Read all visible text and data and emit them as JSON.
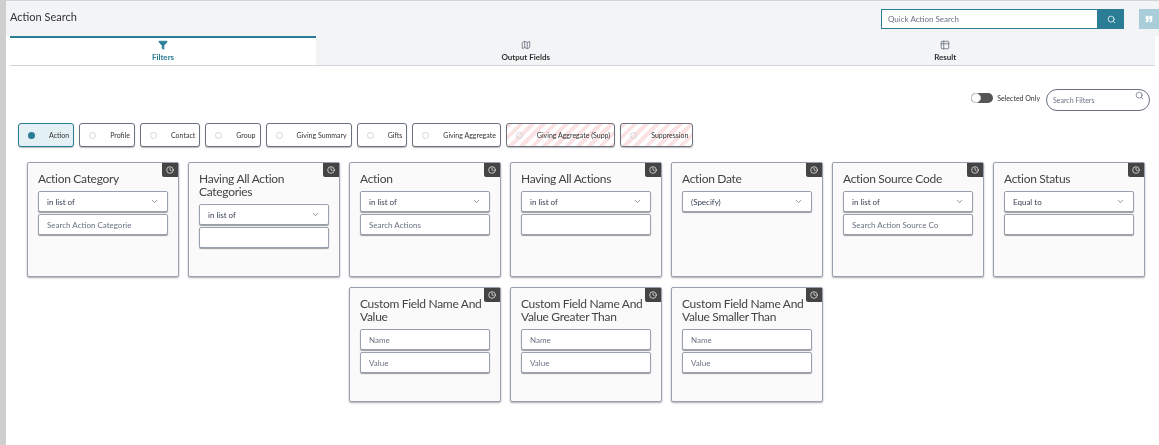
{
  "header": {
    "title": "Action Search",
    "quick_search": {
      "placeholder": "Quick Action Search"
    }
  },
  "tabs": [
    {
      "label": "Filters",
      "kind": "filter",
      "selected": true
    },
    {
      "label": "Output Fields",
      "kind": "map",
      "selected": false
    },
    {
      "label": "Result",
      "kind": "table",
      "selected": false
    }
  ],
  "toolbar": {
    "selected_only": {
      "label": "Selected Only",
      "on": false
    },
    "search": {
      "placeholder": "Search Filters"
    }
  },
  "categories": [
    {
      "label": "Action",
      "selected": true,
      "striped": false
    },
    {
      "label": "Profile",
      "selected": false,
      "striped": false
    },
    {
      "label": "Contact",
      "selected": false,
      "striped": false
    },
    {
      "label": "Group",
      "selected": false,
      "striped": false
    },
    {
      "label": "Giving Summary",
      "selected": false,
      "striped": false
    },
    {
      "label": "Gifts",
      "selected": false,
      "striped": false
    },
    {
      "label": "Giving Aggregate",
      "selected": false,
      "striped": false
    },
    {
      "label": "Giving Aggregate (Supp)",
      "selected": false,
      "striped": true
    },
    {
      "label": "Suppression",
      "selected": false,
      "striped": true
    }
  ],
  "filter_rows": [
    [
      {
        "title": "Action Category",
        "fields": [
          {
            "kind": "select",
            "value": "in list of"
          },
          {
            "kind": "input",
            "placeholder": "Search Action Categorie"
          }
        ]
      },
      {
        "title": "Having All Action Categories",
        "fields": [
          {
            "kind": "select",
            "value": "in list of"
          },
          {
            "kind": "input"
          }
        ]
      },
      {
        "title": "Action",
        "fields": [
          {
            "kind": "select",
            "value": "in list of"
          },
          {
            "kind": "input",
            "placeholder": "Search Actions"
          }
        ]
      },
      {
        "title": "Having All Actions",
        "fields": [
          {
            "kind": "select",
            "value": "in list of"
          },
          {
            "kind": "input"
          }
        ]
      },
      {
        "title": "Action Date",
        "fields": [
          {
            "kind": "select",
            "value": "(Specify)"
          }
        ]
      },
      {
        "title": "Action Source Code",
        "fields": [
          {
            "kind": "select",
            "value": "in list of"
          },
          {
            "kind": "input",
            "placeholder": "Search Action Source Co"
          }
        ]
      },
      {
        "title": "Action Status",
        "fields": [
          {
            "kind": "select",
            "value": "Equal to"
          },
          {
            "kind": "input"
          }
        ]
      }
    ],
    [
      {
        "title": "Custom Field Name And Value",
        "fields": [
          {
            "kind": "input",
            "placeholder": "Name"
          },
          {
            "kind": "input",
            "placeholder": "Value"
          }
        ]
      },
      {
        "title": "Custom Field Name And Value Greater Than",
        "fields": [
          {
            "kind": "input",
            "placeholder": "Name"
          },
          {
            "kind": "input",
            "placeholder": "Value"
          }
        ]
      },
      {
        "title": "Custom Field Name And Value Smaller Than",
        "fields": [
          {
            "kind": "input",
            "placeholder": "Name"
          },
          {
            "kind": "input",
            "placeholder": "Value"
          }
        ]
      }
    ]
  ]
}
